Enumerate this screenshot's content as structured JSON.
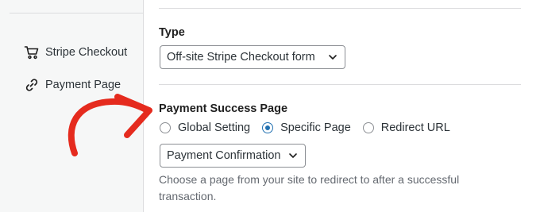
{
  "sidebar": {
    "items": [
      {
        "label": "Stripe Checkout",
        "icon": "cart-icon"
      },
      {
        "label": "Payment Page",
        "icon": "link-icon"
      }
    ]
  },
  "type_field": {
    "label": "Type",
    "selected": "Off-site Stripe Checkout form"
  },
  "success_page": {
    "label": "Payment Success Page",
    "options": [
      {
        "label": "Global Setting",
        "checked": false
      },
      {
        "label": "Specific Page",
        "checked": true
      },
      {
        "label": "Redirect URL",
        "checked": false
      }
    ],
    "page_select": "Payment Confirmation",
    "help": "Choose a page from your site to redirect to after a successful transaction."
  },
  "colors": {
    "accent": "#2271b1",
    "arrow": "#e52b1e"
  }
}
